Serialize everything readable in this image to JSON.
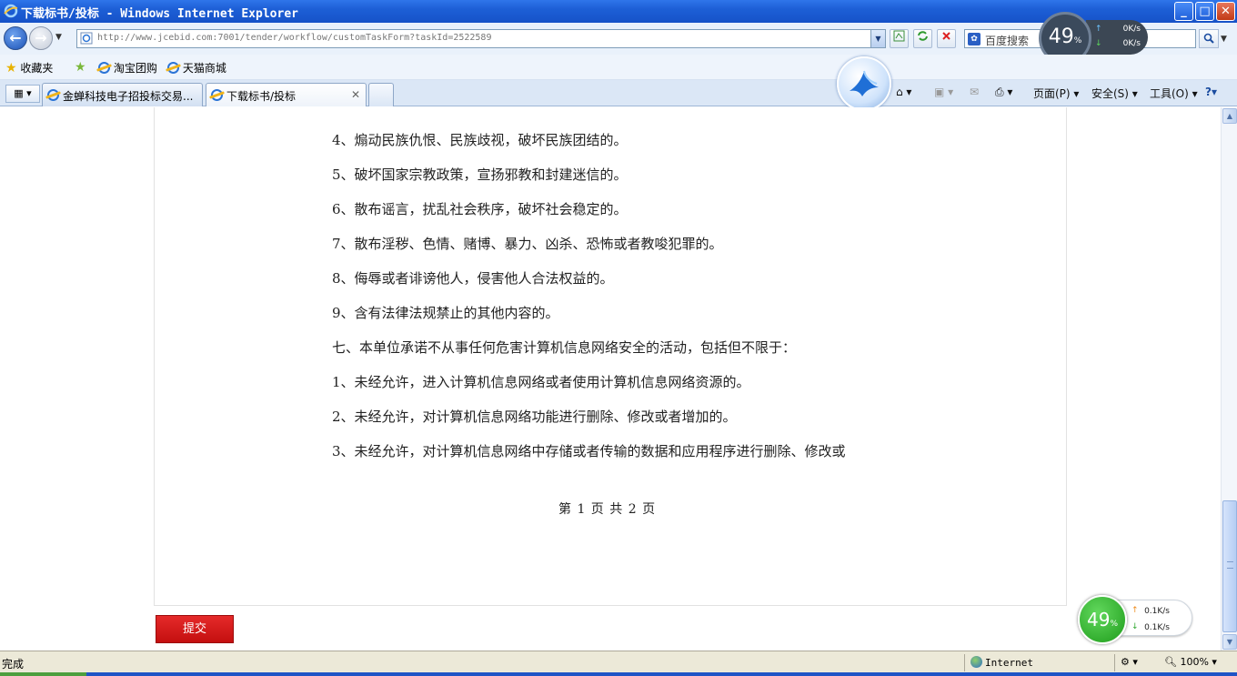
{
  "window": {
    "title": "下载标书/投标 - Windows Internet Explorer",
    "buttons": {
      "minimize": "_",
      "maximize": "□",
      "close": "✕"
    }
  },
  "address_bar": {
    "url": "http://www.jcebid.com:7001/tender/workflow/customTaskForm?taskId=2522589",
    "search_placeholder": "百度搜索"
  },
  "favorites_bar": {
    "favorites_label": "收藏夹",
    "links": [
      "淘宝团购",
      "天猫商城"
    ]
  },
  "tabs": [
    {
      "label": "金蝉科技电子招投标交易..."
    },
    {
      "label": "下载标书/投标"
    }
  ],
  "command_bar": {
    "page": "页面(P)",
    "safety": "安全(S)",
    "tools": "工具(O)"
  },
  "speed_widget_top": {
    "percent": "49",
    "percent_unit": "%",
    "upload": "0K/s",
    "download": "0K/s"
  },
  "speed_widget_float": {
    "percent": "49",
    "percent_unit": "%",
    "upload": "0.1K/s",
    "download": "0.1K/s"
  },
  "document": {
    "lines": [
      "4、煽动民族仇恨、民族歧视，破坏民族团结的。",
      "5、破坏国家宗教政策，宣扬邪教和封建迷信的。",
      "6、散布谣言，扰乱社会秩序，破坏社会稳定的。",
      "7、散布淫秽、色情、赌博、暴力、凶杀、恐怖或者教唆犯罪的。",
      "8、侮辱或者诽谤他人，侵害他人合法权益的。",
      "9、含有法律法规禁止的其他内容的。",
      "七、本单位承诺不从事任何危害计算机信息网络安全的活动，包括但不限于：",
      "1、未经允许，进入计算机信息网络或者使用计算机信息网络资源的。",
      "2、未经允许，对计算机信息网络功能进行删除、修改或者增加的。",
      "3、未经允许，对计算机信息网络中存储或者传输的数据和应用程序进行删除、修改或"
    ],
    "page_indicator": "第 1 页 共 2 页"
  },
  "form": {
    "submit_label": "提交"
  },
  "status_bar": {
    "status": "完成",
    "zone": "Internet",
    "zoom": "100%"
  }
}
